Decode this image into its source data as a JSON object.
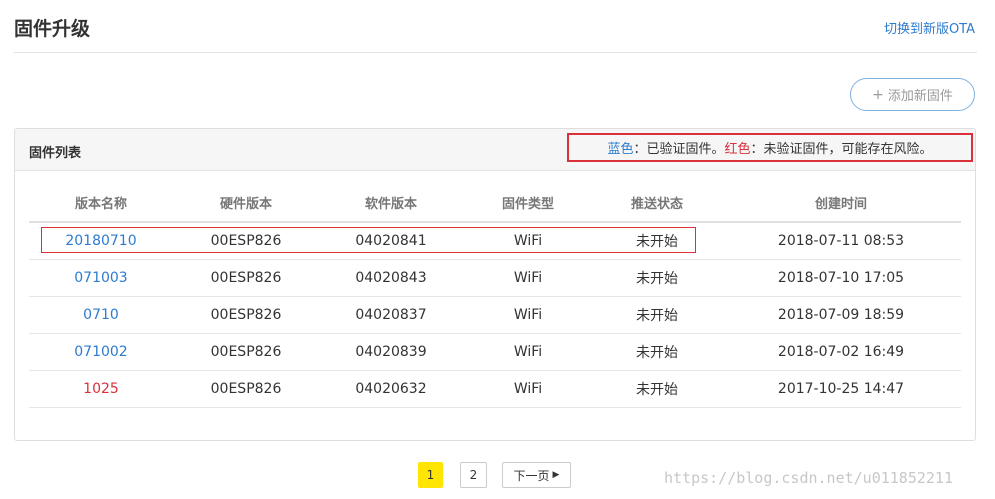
{
  "header": {
    "title": "固件升级",
    "ota_link": "切换到新版OTA"
  },
  "toolbar": {
    "add_icon": "plus-icon",
    "add_label": "添加新固件"
  },
  "panel": {
    "title": "固件列表",
    "legend": {
      "blue_label": "蓝色",
      "blue_desc": "：已验证固件。",
      "red_label": "红色",
      "red_desc": "：未验证固件，可能存在风险。",
      "blue_color": "#2e7bcf",
      "red_color": "#d9303a"
    }
  },
  "table": {
    "headers": [
      "版本名称",
      "硬件版本",
      "软件版本",
      "固件类型",
      "推送状态",
      "创建时间"
    ],
    "rows": [
      {
        "name": "20180710",
        "name_status": "verified",
        "hardware": "00ESP826",
        "software": "04020841",
        "type": "WiFi",
        "push_status": "未开始",
        "created": "2018-07-11 08:53"
      },
      {
        "name": "071003",
        "name_status": "verified",
        "hardware": "00ESP826",
        "software": "04020843",
        "type": "WiFi",
        "push_status": "未开始",
        "created": "2018-07-10 17:05"
      },
      {
        "name": "0710",
        "name_status": "verified",
        "hardware": "00ESP826",
        "software": "04020837",
        "type": "WiFi",
        "push_status": "未开始",
        "created": "2018-07-09 18:59"
      },
      {
        "name": "071002",
        "name_status": "verified",
        "hardware": "00ESP826",
        "software": "04020839",
        "type": "WiFi",
        "push_status": "未开始",
        "created": "2018-07-02 16:49"
      },
      {
        "name": "1025",
        "name_status": "unverified",
        "hardware": "00ESP826",
        "software": "04020632",
        "type": "WiFi",
        "push_status": "未开始",
        "created": "2017-10-25 14:47"
      }
    ]
  },
  "pagination": {
    "pages": [
      "1",
      "2"
    ],
    "current_page": "1",
    "next_label": "下一页",
    "next_icon": "triangle-right-icon",
    "active_color": "#ffe500"
  },
  "watermark": "https://blog.csdn.net/u011852211"
}
